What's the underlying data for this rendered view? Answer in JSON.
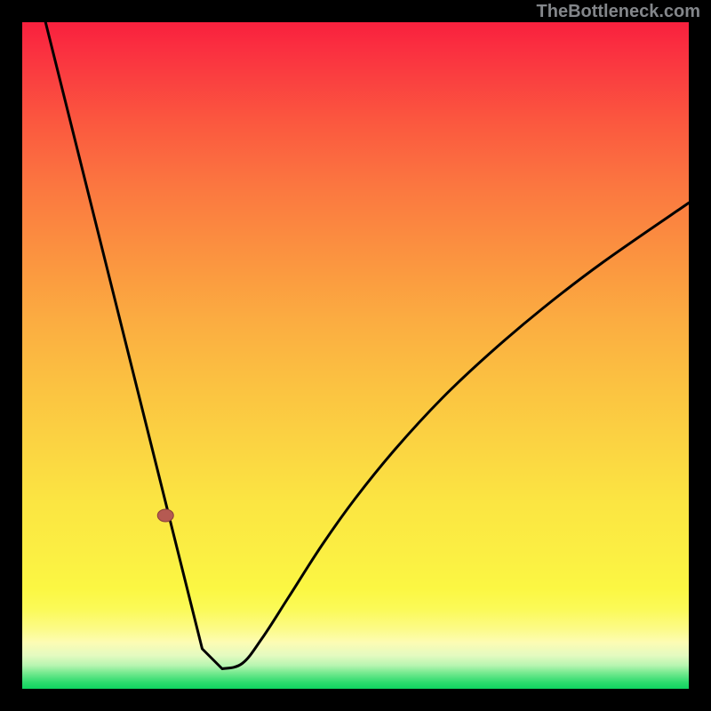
{
  "watermark": "TheBottleneck.com",
  "colors": {
    "frame": "#000000",
    "curve": "#000000",
    "marker_fill": "#b55a52",
    "marker_stroke": "#8a3f3a"
  },
  "chart_data": {
    "type": "line",
    "title": "",
    "xlabel": "",
    "ylabel": "",
    "xlim": [
      0,
      1000
    ],
    "ylim": [
      0,
      1000
    ],
    "grid": false,
    "legend": false,
    "series": [
      {
        "name": "curve",
        "x": [
          35,
          50,
          80,
          110,
          140,
          170,
          185,
          195,
          205,
          215,
          225,
          245,
          270,
          300,
          330,
          360,
          400,
          450,
          500,
          560,
          630,
          700,
          780,
          870,
          1000
        ],
        "y": [
          0,
          62,
          185,
          308,
          432,
          555,
          616,
          658,
          698,
          737,
          776,
          854,
          940,
          970,
          962,
          924,
          862,
          784,
          714,
          640,
          564,
          498,
          430,
          361,
          271
        ]
      }
    ],
    "marker": {
      "x": 215,
      "y": 740,
      "rx": 9,
      "ry": 7
    },
    "note": "x/y are in plot-area pixel coordinates (origin top-left, 750x750). Higher y value = lower on screen. The first series point is the top-left start of the descending limb; the minimum of the V is near x≈205."
  }
}
